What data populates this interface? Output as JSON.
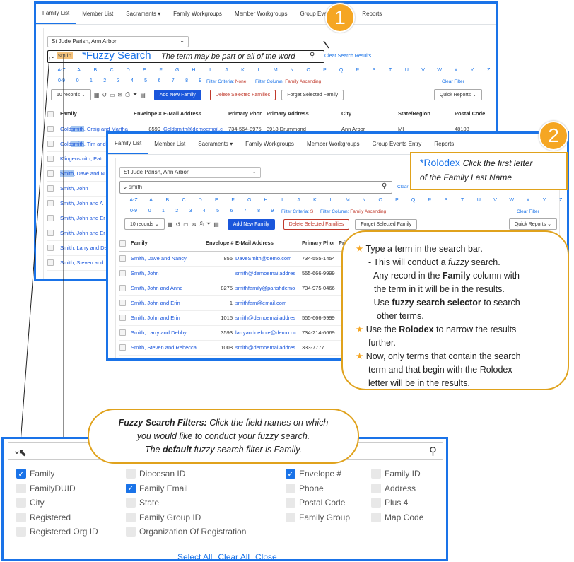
{
  "panel1": {
    "tabs": [
      "Family List",
      "Member List",
      "Sacraments ▾",
      "Family Workgroups",
      "Member Workgroups",
      "Group Events Entry",
      "Reports"
    ],
    "parish": "St Jude Parish, Ann Arbor",
    "search_value": "smith",
    "fuzzy_label": "*Fuzzy Search",
    "fuzzy_note": "The term may be part or all of the word",
    "clear_results": "Clear Search Results",
    "letters": [
      "A-Z",
      "A",
      "B",
      "C",
      "D",
      "E",
      "F",
      "G",
      "H",
      "I",
      "J",
      "K",
      "L",
      "M",
      "N",
      "O",
      "P",
      "Q",
      "R",
      "S",
      "T",
      "U",
      "V",
      "W",
      "X",
      "Y",
      "Z"
    ],
    "digits": [
      "0-9",
      "0",
      "1",
      "2",
      "3",
      "4",
      "5",
      "6",
      "7",
      "8",
      "9"
    ],
    "filter_criteria": "Filter Criteria:",
    "filter_criteria_value": "None",
    "filter_column": "Filter Column:",
    "filter_column_value": "Family Ascending",
    "clear_filter": "Clear Filter",
    "records": "10 records",
    "add_new": "Add New Family",
    "delete_sel": "Delete Selected Families",
    "forget_sel": "Forget Selected Family",
    "quick_reports": "Quick Reports",
    "columns": [
      "Family",
      "Envelope #",
      "E-Mail Address",
      "Primary Phor",
      "Primary Address",
      "City",
      "State/Region",
      "Postal Code"
    ],
    "rows": [
      {
        "family_pre": "",
        "family_hl": "Gold",
        "family_mid": "smith",
        "family_post": ", Craig and Martha",
        "envelope": "8599",
        "email": "Goldsmith@demoemail.c",
        "phone": "734-564-8975",
        "address": "3918 Drummond",
        "city": "Ann Arbor",
        "state": "MI",
        "postal": "48108"
      },
      {
        "family_pre": "",
        "family_hl": "Gold",
        "family_mid": "smith",
        "family_post": ", Tim and",
        "envelope": "",
        "email": "",
        "phone": "",
        "address": "",
        "city": "",
        "state": "",
        "postal": ""
      },
      {
        "family_pre": "Klingensmith, Patr",
        "family_hl": "",
        "family_mid": "",
        "family_post": "",
        "envelope": "",
        "email": "",
        "phone": "",
        "address": "",
        "city": "",
        "state": "",
        "postal": ""
      },
      {
        "family_pre": "",
        "family_hl": "",
        "family_mid": "Smith",
        "family_post": ", Dave and N",
        "envelope": "",
        "email": "",
        "phone": "",
        "address": "",
        "city": "",
        "state": "",
        "postal": ""
      },
      {
        "family_pre": "Smith, John",
        "family_hl": "",
        "family_mid": "",
        "family_post": "",
        "envelope": "",
        "email": "",
        "phone": "",
        "address": "",
        "city": "",
        "state": "",
        "postal": ""
      },
      {
        "family_pre": "Smith, John and A",
        "family_hl": "",
        "family_mid": "",
        "family_post": "",
        "envelope": "",
        "email": "",
        "phone": "",
        "address": "",
        "city": "",
        "state": "",
        "postal": ""
      },
      {
        "family_pre": "Smith, John and Er",
        "family_hl": "",
        "family_mid": "",
        "family_post": "",
        "envelope": "",
        "email": "",
        "phone": "",
        "address": "",
        "city": "",
        "state": "",
        "postal": ""
      },
      {
        "family_pre": "Smith, John and Er",
        "family_hl": "",
        "family_mid": "",
        "family_post": "",
        "envelope": "",
        "email": "",
        "phone": "",
        "address": "",
        "city": "",
        "state": "",
        "postal": ""
      },
      {
        "family_pre": "Smith, Larry and De",
        "family_hl": "",
        "family_mid": "",
        "family_post": "",
        "envelope": "",
        "email": "",
        "phone": "",
        "address": "",
        "city": "",
        "state": "",
        "postal": ""
      },
      {
        "family_pre": "Smith, Steven and",
        "family_hl": "",
        "family_mid": "",
        "family_post": "",
        "envelope": "",
        "email": "",
        "phone": "",
        "address": "",
        "city": "",
        "state": "",
        "postal": ""
      }
    ]
  },
  "panel2": {
    "tabs": [
      "Family List",
      "Member List",
      "Sacraments ▾",
      "Family Workgroups",
      "Member Workgroups",
      "Group Events Entry",
      "Reports"
    ],
    "parish": "St Jude Parish, Ann Arbor",
    "search_value": "smith",
    "clear_short": "Clear",
    "letters": [
      "A-Z",
      "A",
      "B",
      "C",
      "D",
      "E",
      "F",
      "G",
      "H",
      "I",
      "J",
      "K",
      "L",
      "M",
      "N",
      "O",
      "P",
      "Q",
      "R",
      "S",
      "T",
      "U",
      "V",
      "W",
      "X",
      "Y",
      "Z"
    ],
    "digits": [
      "0-9",
      "0",
      "1",
      "2",
      "3",
      "4",
      "5",
      "6",
      "7",
      "8",
      "9"
    ],
    "filter_criteria": "Filter Criteria:",
    "filter_criteria_value": "S",
    "filter_column": "Filter Column:",
    "filter_column_value": "Family Ascending",
    "clear_filter": "Clear Filter",
    "records": "10 records",
    "add_new": "Add New Family",
    "delete_sel": "Delete Selected Families",
    "forget_sel": "Forget Selected Family",
    "quick_reports": "Quick Reports",
    "columns": [
      "Family",
      "Envelope #",
      "E-Mail Address",
      "Primary Phor",
      "Pri"
    ],
    "rows": [
      {
        "family": "Smith, Dave and Nancy",
        "envelope": "855",
        "email": "DaveSmith@demo.com",
        "phone": "734-555-1454"
      },
      {
        "family": "Smith, John",
        "envelope": "",
        "email": "smith@demoemailaddres",
        "phone": "555-666-9999"
      },
      {
        "family": "Smith, John and Anne",
        "envelope": "8275",
        "email": "smithfamily@parishdemo",
        "phone": "734-975-0466"
      },
      {
        "family": "Smith, John and Erin",
        "envelope": "1",
        "email": "smithfam@email.com",
        "phone": ""
      },
      {
        "family": "Smith, John and Erin",
        "envelope": "1015",
        "email": "smith@demoemailaddres",
        "phone": "555-666-9999"
      },
      {
        "family": "Smith, Larry and Debby",
        "envelope": "3593",
        "email": "larryanddebbie@demo.dc",
        "phone": "734-214-6669"
      },
      {
        "family": "Smith, Steven and Rebecca",
        "envelope": "1008",
        "email": "smith@demoemailaddres",
        "phone": "333-7777"
      }
    ]
  },
  "badges": {
    "one": "1",
    "two": "2"
  },
  "rolodex": {
    "title": "*Rolodex",
    "text_a": "Click the first letter",
    "text_b": "of the Family Last Name"
  },
  "instructions": {
    "line1": "Type a term in the search bar.",
    "line2a": "- This will conduct a ",
    "line2b": "fuzzy",
    "line2c": " search.",
    "line3a": "- Any record in the ",
    "line3b": "Family",
    "line3c": " column with",
    "line4": "the term in it will be in the results.",
    "line5a": "- Use ",
    "line5b": "fuzzy search selector",
    "line5c": " to search",
    "line6": "other terms.",
    "line7a": "Use the ",
    "line7b": "Rolodex",
    "line7c": " to narrow the results",
    "line8": "further.",
    "line9": "Now, only terms that contain the search",
    "line10": "term and that begin with the Rolodex",
    "line11": "letter will be in the results."
  },
  "fuzzy_filters": {
    "title": "Fuzzy Search Filters:",
    "text1": "Click the field names on which",
    "text2": "you would like to conduct your fuzzy search.",
    "text3a": "The ",
    "text3b": "default",
    "text3c": " fuzzy search filter is Family.",
    "options": [
      {
        "label": "Family",
        "checked": true
      },
      {
        "label": "Diocesan ID",
        "checked": false
      },
      {
        "label": "Envelope #",
        "checked": true
      },
      {
        "label": "Family ID",
        "checked": false
      },
      {
        "label": "FamilyDUID",
        "checked": false
      },
      {
        "label": "Family Email",
        "checked": true
      },
      {
        "label": "Phone",
        "checked": false
      },
      {
        "label": "Address",
        "checked": false
      },
      {
        "label": "City",
        "checked": false
      },
      {
        "label": "State",
        "checked": false
      },
      {
        "label": "Postal Code",
        "checked": false
      },
      {
        "label": "Plus 4",
        "checked": false
      },
      {
        "label": "Registered",
        "checked": false
      },
      {
        "label": "Family Group ID",
        "checked": false
      },
      {
        "label": "Family Group",
        "checked": false
      },
      {
        "label": "Map Code",
        "checked": false
      },
      {
        "label": "Registered Org ID",
        "checked": false
      },
      {
        "label": "Organization Of Registration",
        "checked": false
      }
    ],
    "select_all": "Select All",
    "clear_all": "Clear All",
    "close": "Close"
  },
  "colors": {
    "accent": "#1a73e8",
    "badge": "#f5a623",
    "callout_border": "#e0a21c"
  }
}
